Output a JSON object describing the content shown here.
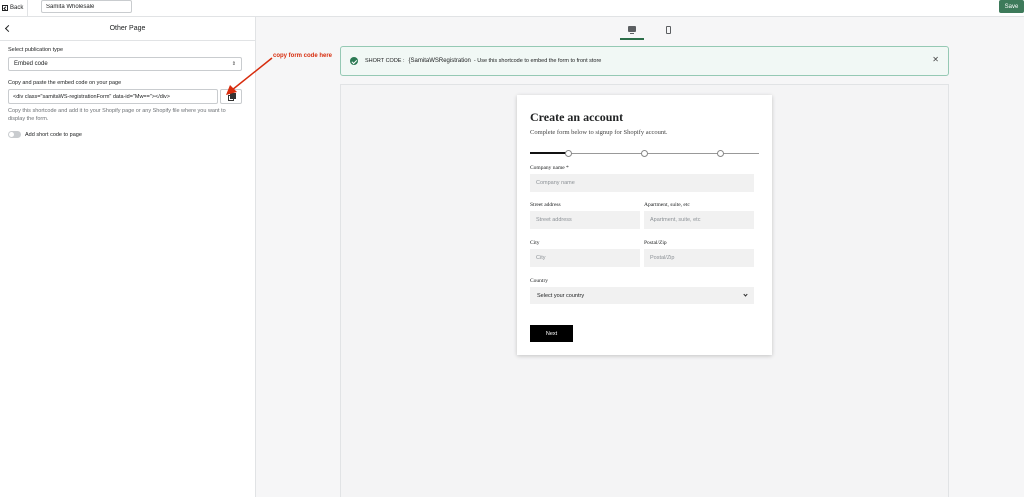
{
  "topbar": {
    "back_label": "Back",
    "app_name": "Samita Wholesale",
    "save_label": "Save"
  },
  "left_panel": {
    "title": "Other Page",
    "publication_type_label": "Select publication type",
    "publication_type_value": "Embed code",
    "embed_label": "Copy and paste the embed code on your page",
    "embed_code": "<div class=\"samitaWS-registrationForm\" data-id=\"Mw==\"></div>",
    "help_text": "Copy this shortcode and add it to your Shopify page or any Shopify file where you want to display the form.",
    "toggle_label": "Add short code to page"
  },
  "annotation": {
    "text": "copy form code here",
    "color": "#d72c0d"
  },
  "preview": {
    "device_icons": [
      "desktop-icon",
      "mobile-icon"
    ],
    "banner_prefix": "SHORT CODE :",
    "banner_code": "{SamitaWSRegistration",
    "banner_suffix": "- Use this shortcode to embed the form to front store"
  },
  "form": {
    "title": "Create an account",
    "subtitle": "Complete form below to signup for Shopify account.",
    "steps": 3,
    "fields": {
      "company_label": "Company name *",
      "company_placeholder": "Company name",
      "street_label": "Street address",
      "street_placeholder": "Street address",
      "apartment_label": "Apartment, suite, etc",
      "apartment_placeholder": "Apartment, suite, etc",
      "city_label": "City",
      "city_placeholder": "City",
      "postal_label": "Postal/Zip",
      "postal_placeholder": "Postal/Zip",
      "country_label": "Country",
      "country_value": "Select your country"
    },
    "next_label": "Next"
  },
  "colors": {
    "accent": "#3d7a5a",
    "success_bg": "#f1f8f5"
  }
}
